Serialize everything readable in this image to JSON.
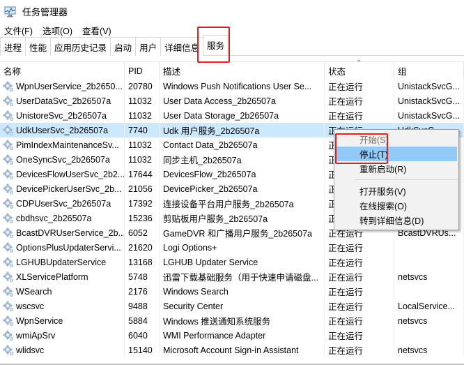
{
  "window": {
    "title": "任务管理器",
    "icon": "task-manager-icon"
  },
  "menu": [
    "文件(F)",
    "选项(O)",
    "查看(V)"
  ],
  "tabs": [
    {
      "label": "进程",
      "active": false
    },
    {
      "label": "性能",
      "active": false
    },
    {
      "label": "应用历史记录",
      "active": false
    },
    {
      "label": "启动",
      "active": false
    },
    {
      "label": "用户",
      "active": false
    },
    {
      "label": "详细信息",
      "active": false
    },
    {
      "label": "服务",
      "active": true
    }
  ],
  "table": {
    "columns": {
      "name": "名称",
      "pid": "PID",
      "desc": "描述",
      "status": "状态",
      "group": "组"
    },
    "sort_column": "status",
    "selected_row": 3,
    "rows": [
      {
        "name": "WpnUserService_2b2650...",
        "pid": "20780",
        "desc": "Windows Push Notifications User Se...",
        "status": "正在运行",
        "group": "UnistackSvcG..."
      },
      {
        "name": "UserDataSvc_2b26507a",
        "pid": "11032",
        "desc": "User Data Access_2b26507a",
        "status": "正在运行",
        "group": "UnistackSvcG..."
      },
      {
        "name": "UnistoreSvc_2b26507a",
        "pid": "11032",
        "desc": "User Data Storage_2b26507a",
        "status": "正在运行",
        "group": "UnistackSvcG..."
      },
      {
        "name": "UdkUserSvc_2b26507a",
        "pid": "7740",
        "desc": "Udk 用户服务_2b26507a",
        "status": "正在运行",
        "group": "UdkSvcG..."
      },
      {
        "name": "PimIndexMaintenanceSv...",
        "pid": "11032",
        "desc": "Contact Data_2b26507a",
        "status": "正在运行",
        "group": ""
      },
      {
        "name": "OneSyncSvc_2b26507a",
        "pid": "11032",
        "desc": "同步主机_2b26507a",
        "status": "正在运行",
        "group": ""
      },
      {
        "name": "DevicesFlowUserSvc_2b2...",
        "pid": "17644",
        "desc": "DevicesFlow_2b26507a",
        "status": "正在运行",
        "group": ""
      },
      {
        "name": "DevicePickerUserSvc_2b...",
        "pid": "21056",
        "desc": "DevicePicker_2b26507a",
        "status": "正在运行",
        "group": ""
      },
      {
        "name": "CDPUserSvc_2b26507a",
        "pid": "17392",
        "desc": "连接设备平台用户服务_2b26507a",
        "status": "正在运行",
        "group": ""
      },
      {
        "name": "cbdhsvc_2b26507a",
        "pid": "15236",
        "desc": "剪贴板用户服务_2b26507a",
        "status": "正在运行",
        "group": ""
      },
      {
        "name": "BcastDVRUserService_2b...",
        "pid": "6052",
        "desc": "GameDVR 和广播用户服务_2b26507a",
        "status": "正在运行",
        "group": "BcastDVRUs..."
      },
      {
        "name": "OptionsPlusUpdaterServi...",
        "pid": "21620",
        "desc": "Logi Options+",
        "status": "正在运行",
        "group": ""
      },
      {
        "name": "LGHUBUpdaterService",
        "pid": "13168",
        "desc": "LGHUB Updater Service",
        "status": "正在运行",
        "group": ""
      },
      {
        "name": "XLServicePlatform",
        "pid": "5748",
        "desc": "迅雷下载基础服务（用于快速申请磁盘...",
        "status": "正在运行",
        "group": "netsvcs"
      },
      {
        "name": "WSearch",
        "pid": "2176",
        "desc": "Windows Search",
        "status": "正在运行",
        "group": ""
      },
      {
        "name": "wscsvc",
        "pid": "9488",
        "desc": "Security Center",
        "status": "正在运行",
        "group": "LocalService..."
      },
      {
        "name": "WpnService",
        "pid": "5884",
        "desc": "Windows 推送通知系统服务",
        "status": "正在运行",
        "group": "netsvcs"
      },
      {
        "name": "wmiApSrv",
        "pid": "6040",
        "desc": "WMI Performance Adapter",
        "status": "正在运行",
        "group": ""
      },
      {
        "name": "wlidsvc",
        "pid": "15140",
        "desc": "Microsoft Account Sign-in Assistant",
        "status": "正在运行",
        "group": "netsvcs"
      }
    ]
  },
  "context_menu": {
    "items": [
      {
        "label": "开始(S)",
        "disabled": true,
        "highlighted": false
      },
      {
        "label": "停止(T)",
        "disabled": false,
        "highlighted": true
      },
      {
        "label": "重新启动(R)",
        "disabled": false,
        "highlighted": false
      },
      {
        "separator": true
      },
      {
        "label": "打开服务(V)",
        "disabled": false,
        "highlighted": false
      },
      {
        "label": "在线搜索(O)",
        "disabled": false,
        "highlighted": false
      },
      {
        "label": "转到详细信息(D)",
        "disabled": false,
        "highlighted": false
      }
    ]
  },
  "annotations": {
    "highlight_color": "#e81e1e"
  }
}
